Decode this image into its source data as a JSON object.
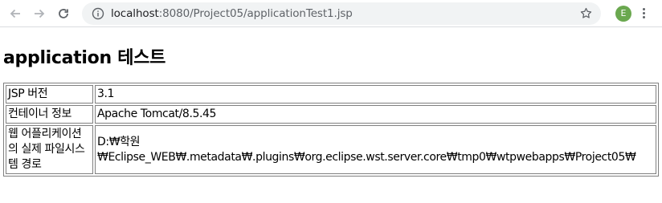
{
  "browser": {
    "url_host": "localhost",
    "url_rest": ":8080/Project05/applicationTest1.jsp",
    "profile_initial": "E"
  },
  "page": {
    "title": "application 테스트",
    "rows": [
      {
        "label": "JSP 버전",
        "value": "3.1"
      },
      {
        "label": "컨테이너 정보",
        "value": "Apache Tomcat/8.5.45"
      },
      {
        "label": "웹 어플리케이션의 실제 파일시스템 경로",
        "value": "D:₩학원₩Eclipse_WEB₩.metadata₩.plugins₩org.eclipse.wst.server.core₩tmp0₩wtpwebapps₩Project05₩"
      }
    ]
  },
  "colors": {
    "profile_bg": "#6aa84f",
    "omnibox_bg": "#f1f3f4"
  }
}
